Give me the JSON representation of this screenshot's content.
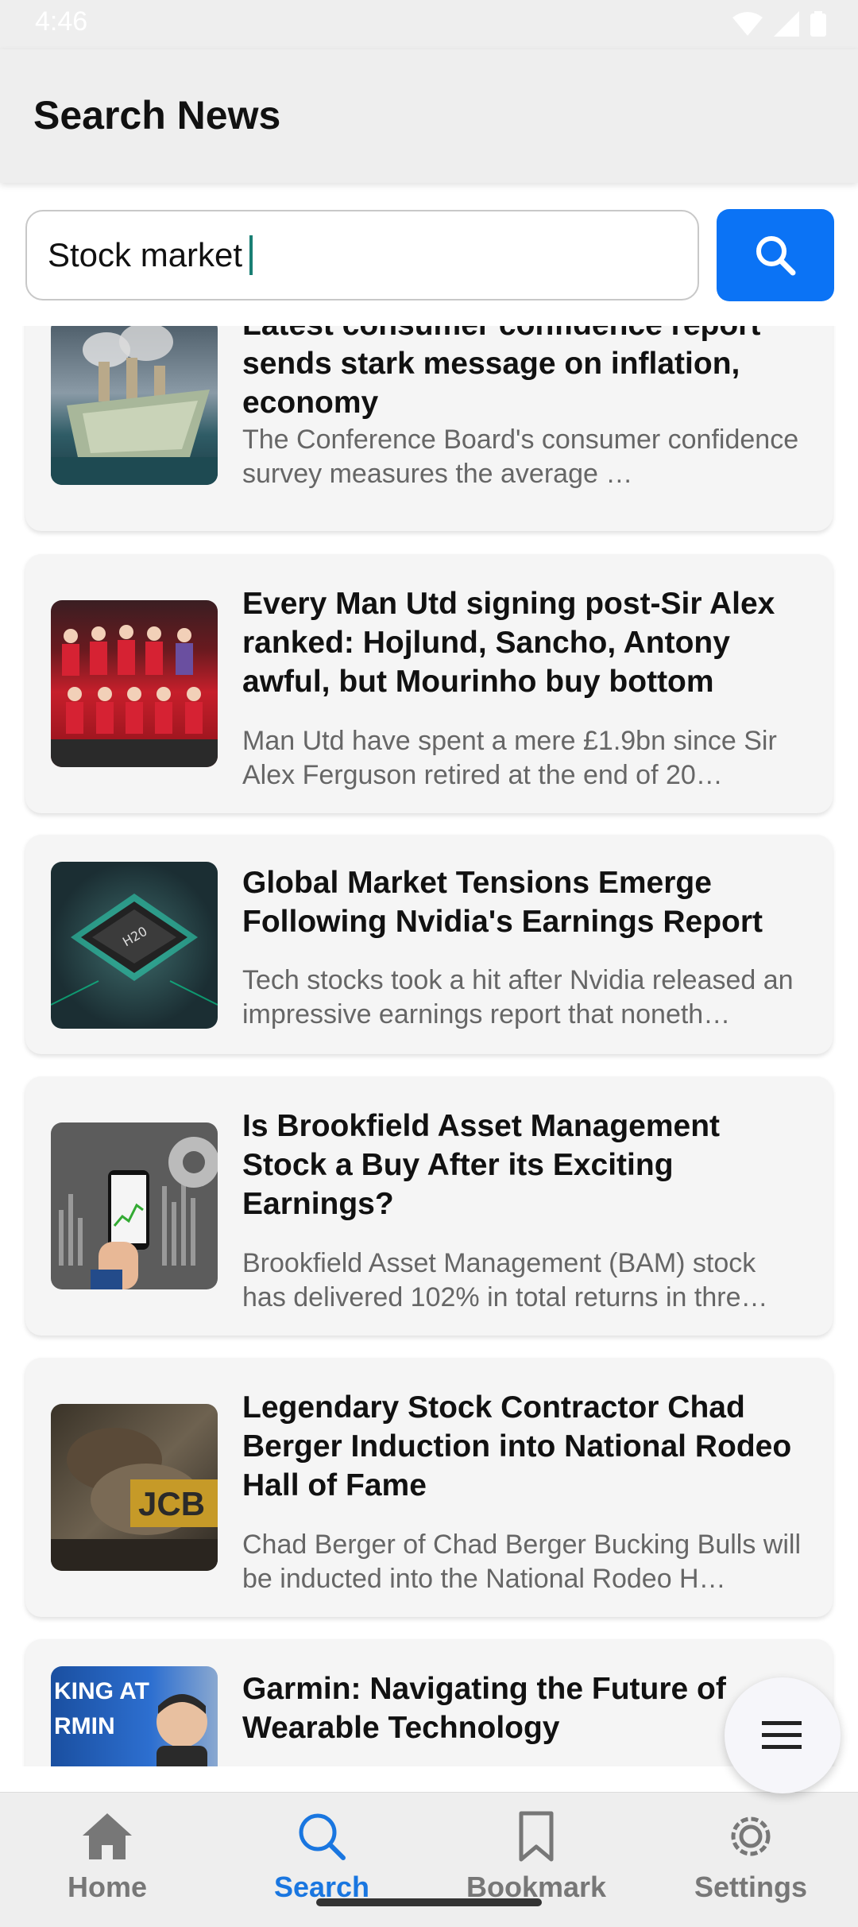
{
  "status_bar": {
    "time": "4:46"
  },
  "app_bar": {
    "title": "Search News"
  },
  "search": {
    "value": "Stock market",
    "button_icon": "search-icon"
  },
  "articles": [
    {
      "title": "Latest consumer confidence report sends stark message on inflation, economy",
      "description": "The Conference Board's consumer confidence survey measures the average …"
    },
    {
      "title": "Every Man Utd signing post-Sir Alex ranked: Hojlund, Sancho, Antony awful, but Mourinho buy bottom",
      "description": "Man Utd have spent a mere £1.9bn since Sir Alex Ferguson retired at the end of 20…"
    },
    {
      "title": "Global Market Tensions Emerge Following Nvidia's Earnings Report",
      "description": "Tech stocks took a hit after Nvidia released an impressive earnings report that noneth…"
    },
    {
      "title": "Is Brookfield Asset Management Stock a Buy After its Exciting Earnings?",
      "description": "Brookfield Asset Management (BAM) stock has delivered 102% in total returns in thre…"
    },
    {
      "title": "Legendary Stock Contractor Chad Berger Induction into National Rodeo Hall of Fame",
      "description": "Chad Berger of Chad Berger Bucking Bulls will be inducted into the National Rodeo H…"
    },
    {
      "title": "Garmin: Navigating the Future of Wearable Technology",
      "description": "",
      "thumb_text": "KING AT\nRMIN"
    }
  ],
  "fab": {
    "icon": "menu-icon"
  },
  "bottom_nav": {
    "items": [
      {
        "label": "Home",
        "icon": "home-icon",
        "active": false
      },
      {
        "label": "Search",
        "icon": "search-icon",
        "active": true
      },
      {
        "label": "Bookmark",
        "icon": "bookmark-icon",
        "active": false
      },
      {
        "label": "Settings",
        "icon": "settings-icon",
        "active": false
      }
    ]
  },
  "colors": {
    "accent": "#0b73f5",
    "active_nav": "#1976e0",
    "caret": "#1a7f74"
  }
}
